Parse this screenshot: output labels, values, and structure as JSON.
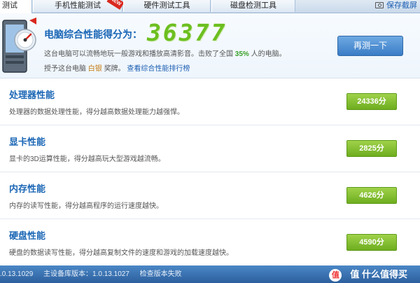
{
  "tabs": [
    {
      "label": "测试",
      "active": true
    },
    {
      "label": "手机性能测试",
      "active": false,
      "badge": "NEW"
    },
    {
      "label": "硬件测试工具",
      "active": false
    },
    {
      "label": "磁盘检测工具",
      "active": false
    }
  ],
  "save_screenshot": "保存截屏",
  "header": {
    "title": "电脑综合性能得分为：",
    "score": "36377",
    "desc_prefix": "这台电脑可以流畅地玩一般游戏和播放高清影音。击败了全国",
    "percent": "35%",
    "desc_suffix": "人的电脑。",
    "award_prefix": "授予这台电脑",
    "award_medal": "白银",
    "award_suffix": "奖牌。",
    "ranking_link": "查看综合性能排行榜",
    "retest_button": "再测一下"
  },
  "rows": [
    {
      "title": "处理器性能",
      "desc": "处理器的数据处理性能，得分越高数据处理能力越强悍。",
      "score": "24336分"
    },
    {
      "title": "显卡性能",
      "desc": "显卡的3D运算性能，得分越高玩大型游戏越流畅。",
      "score": "2825分"
    },
    {
      "title": "内存性能",
      "desc": "内存的读写性能，得分越高程序的运行速度越快。",
      "score": "4626分"
    },
    {
      "title": "硬盘性能",
      "desc": "硬盘的数据读写性能，得分越高复制文件的速度和游戏的加载速度越快。",
      "score": "4590分"
    }
  ],
  "status": {
    "version": ".0.13.1029",
    "device_lib": "主设备库版本：1.0.13.1027",
    "check": "检查版本失败"
  },
  "watermark": "值 什么值得买",
  "watermark_icon": "值",
  "colors": {
    "accent_blue": "#1a66b5",
    "score_green": "#6cbf1f",
    "badge_green": "#7fb92a",
    "status_bar": "#2c5f9d"
  }
}
